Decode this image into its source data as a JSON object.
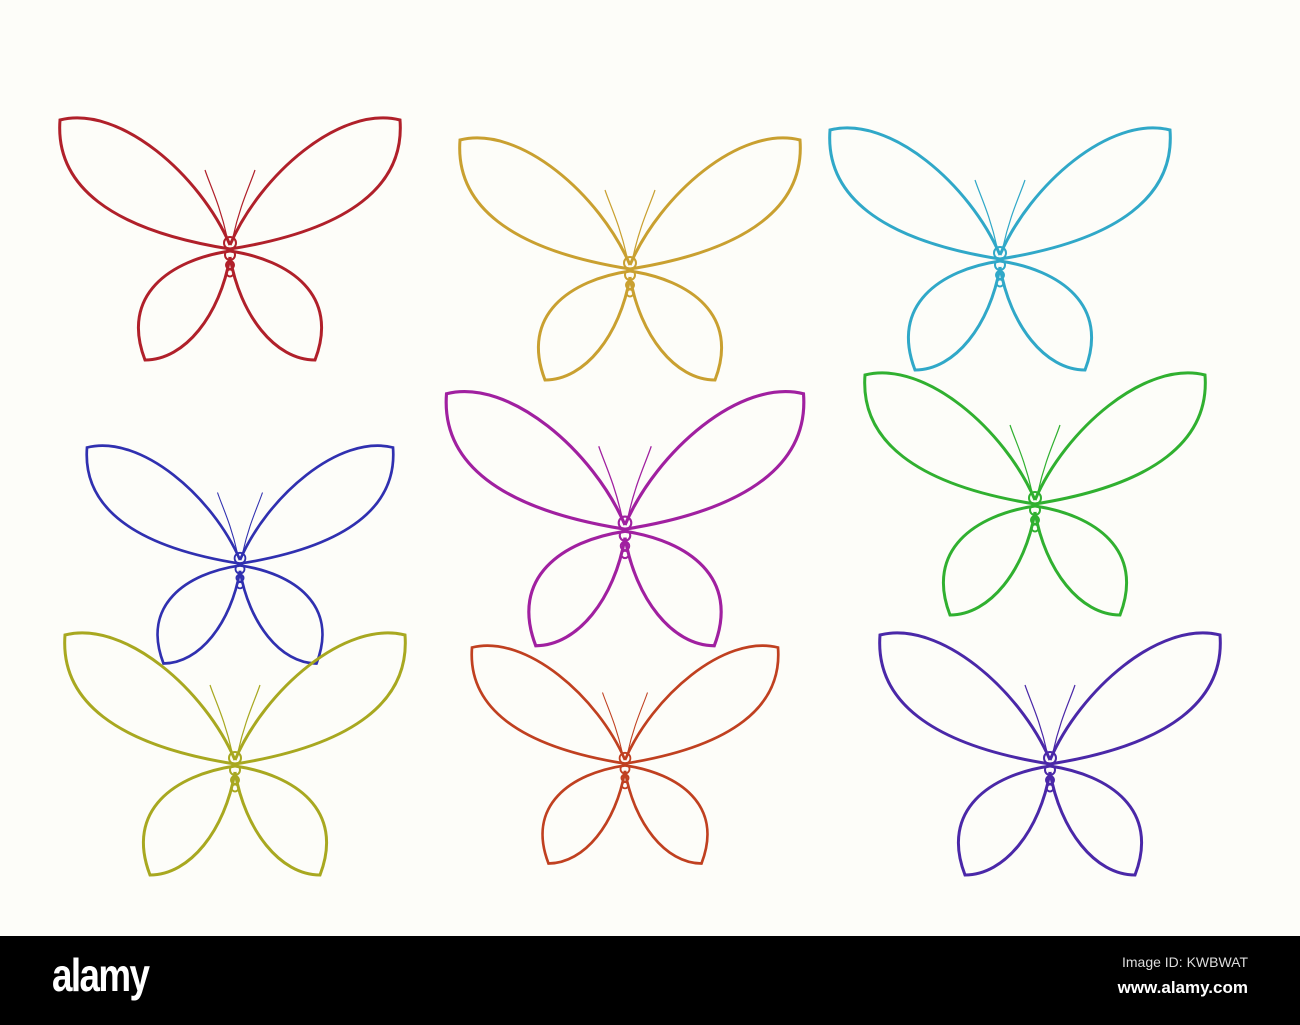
{
  "image": {
    "butterflies": [
      {
        "color": "#b0202a"
      },
      {
        "color": "#c9a030"
      },
      {
        "color": "#30a8c8"
      },
      {
        "color": "#3030b0"
      },
      {
        "color": "#a020a0"
      },
      {
        "color": "#30b030"
      },
      {
        "color": "#a8a820"
      },
      {
        "color": "#c04020"
      },
      {
        "color": "#4a28a8"
      }
    ]
  },
  "footer": {
    "logo": "alamy",
    "image_id": "Image ID: KWBWAT",
    "url": "www.alamy.com"
  }
}
